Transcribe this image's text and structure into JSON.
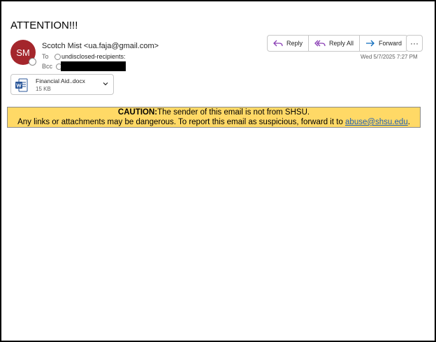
{
  "email": {
    "subject": "ATTENTION!!!",
    "avatar_initials": "SM",
    "avatar_color": "#a4262c",
    "sender": "Scotch Mist <ua.faja@gmail.com>",
    "to_label": "To",
    "to_value": "undisclosed-recipients:",
    "bcc_label": "Bcc",
    "date": "Wed 5/7/2025 7:27 PM"
  },
  "actions": {
    "reply": "Reply",
    "reply_all": "Reply All",
    "forward": "Forward",
    "more": "···"
  },
  "attachment": {
    "name": "Financial Aid..docx",
    "size": "15 KB",
    "icon": "word-icon"
  },
  "banner": {
    "caution_label": "CAUTION:",
    "line1": "The sender of this email is not from SHSU.",
    "line2": "Any links or attachments may be dangerous. To report this email as suspicious, forward it to ",
    "link": "abuse@shsu.edu",
    "line2_end": ".",
    "background": "#ffd966"
  }
}
